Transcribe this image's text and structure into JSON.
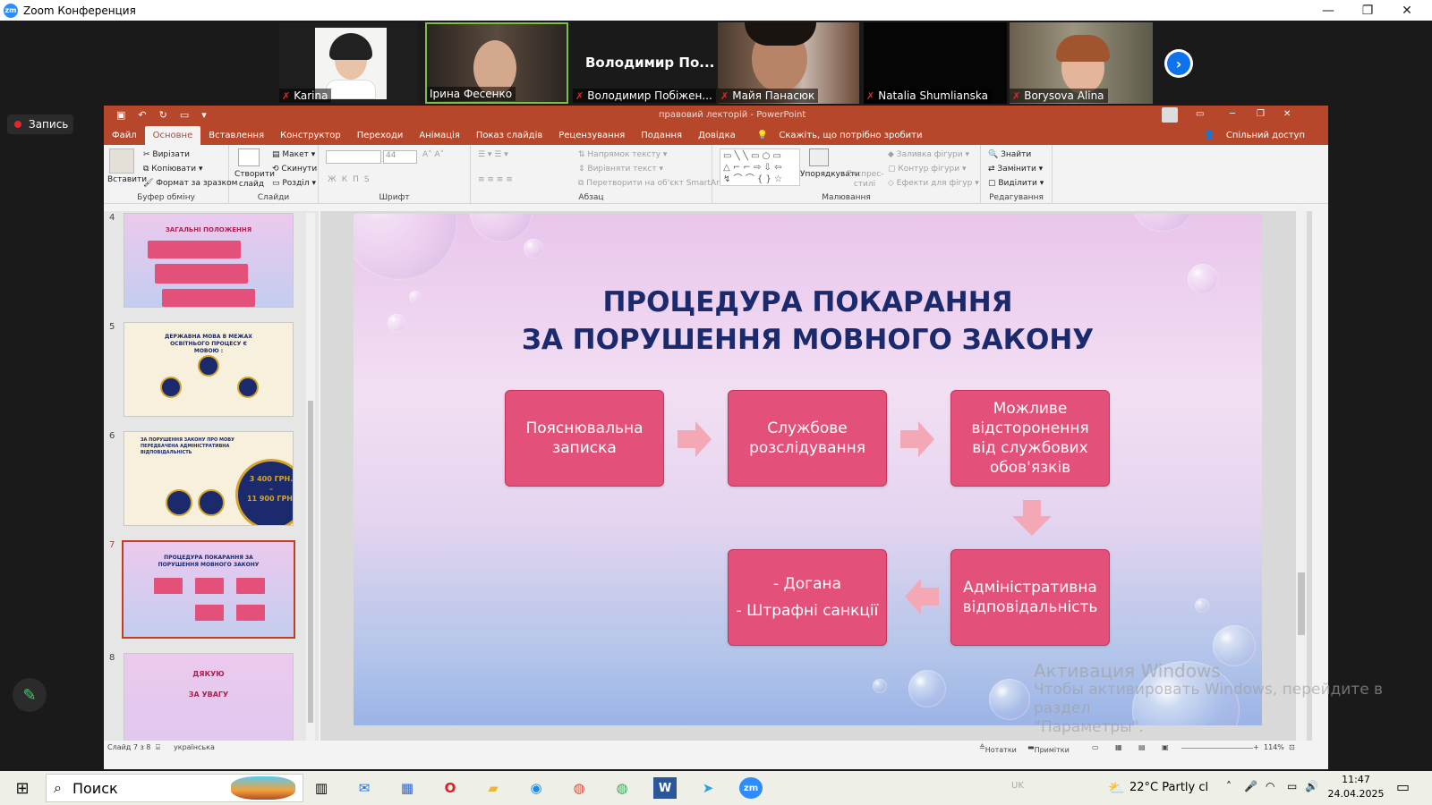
{
  "zoom": {
    "window_title": "Zoom Конференция",
    "minimize": "—",
    "restore": "❐",
    "close": "✕",
    "record_label": "Запись",
    "next_arrow": "›",
    "participants": [
      {
        "name": "Karina",
        "muted": true
      },
      {
        "name": "Ірина Фесенко",
        "muted": false
      },
      {
        "name": "Володимир Побіжен...",
        "muted": true,
        "display_name": "Володимир  По..."
      },
      {
        "name": "Майя Панасюк",
        "muted": true
      },
      {
        "name": "Natalia Shumlianska",
        "muted": true
      },
      {
        "name": "Borysova Alina",
        "muted": true
      }
    ]
  },
  "ppt": {
    "doc_title": "правовий лекторій  -  PowerPoint",
    "tabs": [
      "Файл",
      "Основне",
      "Вставлення",
      "Конструктор",
      "Переходи",
      "Анімація",
      "Показ слайдів",
      "Рецензування",
      "Подання",
      "Довідка"
    ],
    "tell_me": "Скажіть, що потрібно зробити",
    "share": "Спільний доступ",
    "ribbon": {
      "paste": "Вставити",
      "cut": "Вирізати",
      "copy": "Копіювати",
      "format_painter": "Формат за зразком",
      "clipboard_label": "Буфер обміну",
      "new_slide": "Створити слайд",
      "layout": "Макет",
      "reset": "Скинути",
      "section": "Розділ",
      "slides_label": "Слайди",
      "font_size": "44",
      "font_label": "Шрифт",
      "text_direction": "Напрямок тексту",
      "align_text": "Вирівняти текст",
      "smartart": "Перетворити на об'єкт SmartArt",
      "paragraph_label": "Абзац",
      "arrange": "Упорядкувати",
      "quick_styles": "Експрес-стилі",
      "shape_fill": "Заливка фігури",
      "shape_outline": "Контур фігури",
      "shape_effects": "Ефекти для фігур",
      "drawing_label": "Малювання",
      "find": "Знайти",
      "replace": "Замінити",
      "select": "Виділити",
      "editing_label": "Редагування"
    },
    "thumbnails": [
      {
        "num": "4",
        "title": "ЗАГАЛЬНІ ПОЛОЖЕННЯ"
      },
      {
        "num": "5",
        "title": "ДЕРЖАВНА МОВА В МЕЖАХ ОСВІТНЬОГО ПРОЦЕСУ Є МОВОЮ :"
      },
      {
        "num": "6",
        "title": "ЗА ПОРУШЕННЯ ЗАКОНУ ПРО МОВУ ПЕРЕДБАЧЕНА АДМІНІСТРАТИВНА ВІДПОВІДАЛЬНІСТЬ",
        "amount1": "3 400 ГРН.",
        "dash": "–",
        "amount2": "11 900 ГРН."
      },
      {
        "num": "7",
        "title": "ПРОЦЕДУРА ПОКАРАННЯ ЗА ПОРУШЕННЯ МОВНОГО ЗАКОНУ"
      },
      {
        "num": "8",
        "title": "ДЯКУЮ",
        "subtitle": "ЗА УВАГУ"
      }
    ],
    "slide": {
      "title_line1": "ПРОЦЕДУРА ПОКАРАННЯ",
      "title_line2": "ЗА ПОРУШЕННЯ МОВНОГО ЗАКОНУ",
      "box1": "Пояснювальна записка",
      "box2": "Службове розслідування",
      "box3": "Можливе відсторонення від службових обов'язків",
      "box4": "Адміністративна відповідальність",
      "box5_line1": "- Догана",
      "box5_line2": "- Штрафні санкції"
    },
    "status": {
      "slide_of": "Слайд 7 з 8",
      "language": "українська",
      "notes": "Нотатки",
      "comments": "Примітки",
      "zoom": "114%"
    }
  },
  "watermark": {
    "line1": "Активация Windows",
    "line2": "Чтобы активировать Windows, перейдите в раздел",
    "line3": "\"Параметры\"."
  },
  "taskbar": {
    "search_placeholder": "Поиск",
    "weather": "22°C  Partly cl",
    "time": "11:47",
    "date": "24.04.2025",
    "lang": "UK"
  }
}
